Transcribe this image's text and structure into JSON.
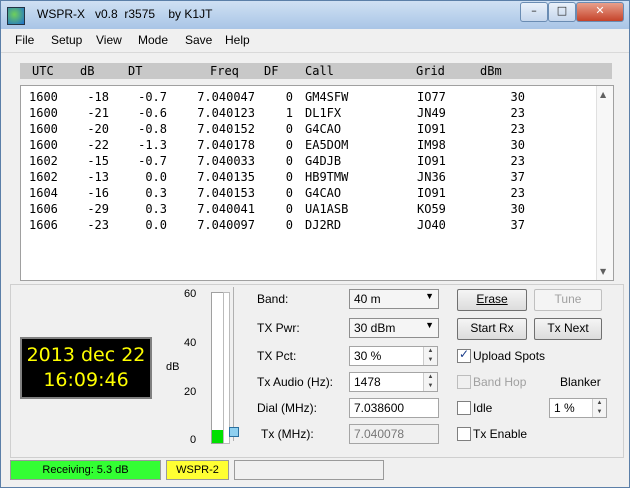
{
  "window": {
    "title": "WSPR-X   v0.8  r3575    by K1JT"
  },
  "window_controls": {
    "minimize": "–",
    "maximize": "□",
    "close": "✕"
  },
  "menu": [
    "File",
    "Setup",
    "View",
    "Mode",
    "Save",
    "Help"
  ],
  "table": {
    "headers": [
      "UTC",
      "dB",
      "DT",
      "Freq",
      "DF",
      "Call",
      "Grid",
      "dBm"
    ],
    "rows": [
      [
        "1600",
        "-18",
        "-0.7",
        "7.040047",
        "0",
        "GM4SFW",
        "IO77",
        "30"
      ],
      [
        "1600",
        "-21",
        "-0.6",
        "7.040123",
        "1",
        "DL1FX",
        "JN49",
        "23"
      ],
      [
        "1600",
        "-20",
        "-0.8",
        "7.040152",
        "0",
        "G4CAO",
        "IO91",
        "23"
      ],
      [
        "1600",
        "-22",
        "-1.3",
        "7.040178",
        "0",
        "EA5DOM",
        "IM98",
        "30"
      ],
      [
        "1602",
        "-15",
        "-0.7",
        "7.040033",
        "0",
        "G4DJB",
        "IO91",
        "23"
      ],
      [
        "1602",
        "-13",
        "0.0",
        "7.040135",
        "0",
        "HB9TMW",
        "JN36",
        "37"
      ],
      [
        "1604",
        "-16",
        "0.3",
        "7.040153",
        "0",
        "G4CAO",
        "IO91",
        "23"
      ],
      [
        "1606",
        "-29",
        "0.3",
        "7.040041",
        "0",
        "UA1ASB",
        "KO59",
        "30"
      ],
      [
        "1606",
        "-23",
        "0.0",
        "7.040097",
        "0",
        "DJ2RD",
        "JO40",
        "37"
      ]
    ]
  },
  "clock": {
    "date": "2013 dec 22",
    "time": "16:09:46"
  },
  "meter": {
    "scale": [
      "60",
      "40",
      "20",
      "0"
    ],
    "unit": "dB",
    "level_fraction": 0.09
  },
  "controls": {
    "band_label": "Band:",
    "band_value": "40 m",
    "txpwr_label": "TX Pwr:",
    "txpwr_value": "30 dBm",
    "txpct_label": "TX Pct:",
    "txpct_value": "30  %",
    "txaudio_label": "Tx Audio (Hz):",
    "txaudio_value": "1478",
    "dial_label": "Dial (MHz):",
    "dial_value": "7.038600",
    "tx_label": "Tx  (MHz):",
    "tx_value": "7.040078"
  },
  "buttons": {
    "erase": "Erase",
    "tune": "Tune",
    "start_rx": "Start Rx",
    "tx_next": "Tx Next"
  },
  "checks": {
    "upload_spots": "Upload Spots",
    "band_hop": "Band Hop",
    "idle": "Idle",
    "tx_enable": "Tx Enable"
  },
  "blanker": {
    "label": "Blanker",
    "value": "1 %"
  },
  "status": {
    "receiving": "Receiving:   5.3 dB",
    "mode": "WSPR-2",
    "message": ""
  },
  "colors": {
    "receiving_bg": "#33ff33",
    "mode_bg": "#ffff33",
    "clock_text": "#ffff00",
    "clock_bg": "#000000",
    "meter_fill": "#00e000"
  }
}
